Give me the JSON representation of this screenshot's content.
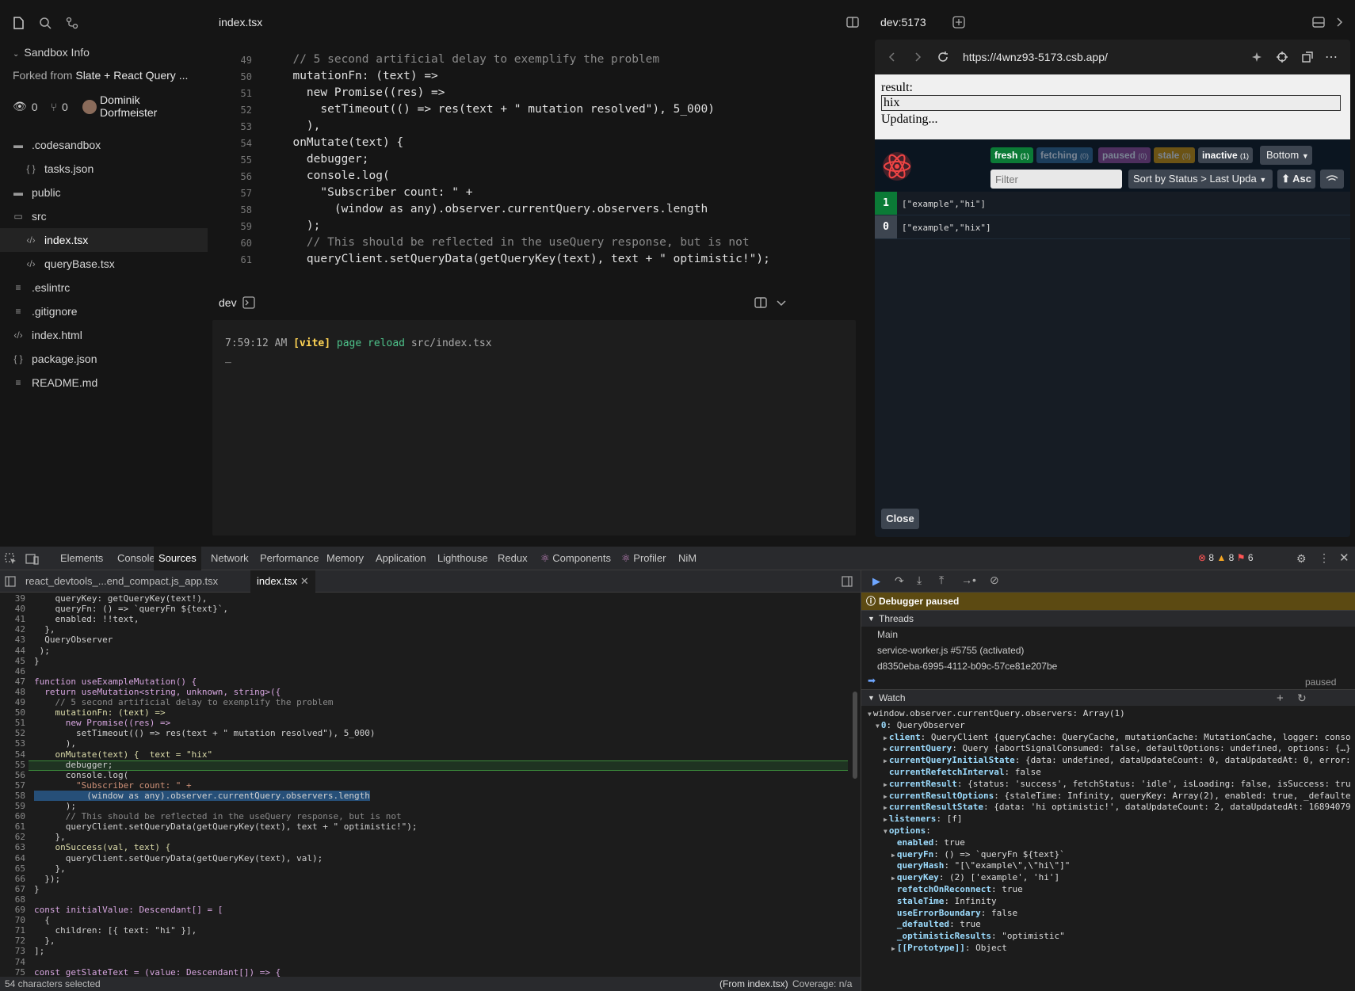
{
  "sidebar": {
    "section_title": "Sandbox Info",
    "forked_label": "Forked from",
    "forked_name": "Slate + React Query ...",
    "views": "0",
    "forks": "0",
    "author": "Dominik Dorfmeister",
    "files": [
      {
        "name": ".codesandbox",
        "icon": "folder-icon"
      },
      {
        "name": "tasks.json",
        "icon": "json-icon"
      },
      {
        "name": "public",
        "icon": "folder-icon"
      },
      {
        "name": "src",
        "icon": "folder-open-icon"
      },
      {
        "name": "index.tsx",
        "icon": "code-icon"
      },
      {
        "name": "queryBase.tsx",
        "icon": "code-icon"
      },
      {
        "name": ".eslintrc",
        "icon": "lines-icon"
      },
      {
        "name": ".gitignore",
        "icon": "lines-icon"
      },
      {
        "name": "index.html",
        "icon": "code-icon"
      },
      {
        "name": "package.json",
        "icon": "json-icon"
      },
      {
        "name": "README.md",
        "icon": "lines-icon"
      }
    ]
  },
  "editor": {
    "tab": "index.tsx",
    "lines": [
      {
        "n": "49",
        "t": "  // 5 second artificial delay to exemplify the problem"
      },
      {
        "n": "50",
        "t": "  mutationFn: (text) =>"
      },
      {
        "n": "51",
        "t": "    new Promise((res) =>"
      },
      {
        "n": "52",
        "t": "      setTimeout(() => res(text + \" mutation resolved\"), 5_000)"
      },
      {
        "n": "53",
        "t": "    ),"
      },
      {
        "n": "54",
        "t": "  onMutate(text) {"
      },
      {
        "n": "55",
        "t": "    debugger;"
      },
      {
        "n": "56",
        "t": "    console.log("
      },
      {
        "n": "57",
        "t": "      \"Subscriber count: \" +"
      },
      {
        "n": "58",
        "t": "        (window as any).observer.currentQuery.observers.length"
      },
      {
        "n": "59",
        "t": "    );"
      },
      {
        "n": "60",
        "t": "    // This should be reflected in the useQuery response, but is not"
      },
      {
        "n": "61",
        "t": "    queryClient.setQueryData(getQueryKey(text), text + \" optimistic!\");"
      }
    ]
  },
  "terminal": {
    "title": "dev",
    "time": "7:59:12 AM",
    "tag": "[vite]",
    "msg": "page reload",
    "path": "src/index.tsx",
    "cursor": "_"
  },
  "preview": {
    "title": "dev:5173",
    "url": "https://4wnz93-5173.csb.app/",
    "result_label": "result:",
    "input_value": "hix",
    "status": "Updating...",
    "close": "Close"
  },
  "rq_devtools": {
    "badges": [
      {
        "label": "fresh",
        "count": "(1)",
        "color": "#0b7a36"
      },
      {
        "label": "fetching",
        "count": "(0)",
        "color": "#1c3e5c"
      },
      {
        "label": "paused",
        "count": "(0)",
        "color": "#4d2f5e"
      },
      {
        "label": "stale",
        "count": "(0)",
        "color": "#6b5315"
      },
      {
        "label": "inactive",
        "count": "(1)",
        "color": "#3d4550"
      }
    ],
    "position_select": "Bottom",
    "filter_placeholder": "Filter",
    "sort_select": "Sort by Status > Last Upda",
    "asc": "⬆ Asc",
    "queries": [
      {
        "count": "1",
        "key": "[\"example\",\"hi\"]",
        "color": "#0b7a36"
      },
      {
        "count": "0",
        "key": "[\"example\",\"hix\"]",
        "color": "#3d4550"
      }
    ]
  },
  "devtools": {
    "tabs": [
      "Elements",
      "Console",
      "Sources",
      "Network",
      "Performance",
      "Memory",
      "Application",
      "Lighthouse",
      "Redux",
      "Components",
      "Profiler",
      "NiM"
    ],
    "active_tab": "Sources",
    "errors": "8",
    "warnings": "8",
    "issues": "6",
    "file_tabs": [
      "react_devtools_...end_compact.js",
      "_app.tsx",
      "index.tsx"
    ],
    "status_left": "54 characters selected",
    "status_mid": "(From index.tsx)",
    "status_right": "Coverage: n/a",
    "src_lines": [
      {
        "n": "39",
        "t": "    queryKey: getQueryKey(text!),"
      },
      {
        "n": "40",
        "t": "    queryFn: () => `queryFn ${text}`,"
      },
      {
        "n": "41",
        "t": "    enabled: !!text,"
      },
      {
        "n": "42",
        "t": "  },"
      },
      {
        "n": "43",
        "t": "  QueryObserver"
      },
      {
        "n": "44",
        "t": " );"
      },
      {
        "n": "45",
        "t": "}"
      },
      {
        "n": "46",
        "t": ""
      },
      {
        "n": "47",
        "t": "function useExampleMutation() {"
      },
      {
        "n": "48",
        "t": "  return useMutation<string, unknown, string>({"
      },
      {
        "n": "49",
        "t": "    // 5 second artificial delay to exemplify the problem"
      },
      {
        "n": "50",
        "t": "    mutationFn: (text) =>"
      },
      {
        "n": "51",
        "t": "      new Promise((res) =>"
      },
      {
        "n": "52",
        "t": "        setTimeout(() => res(text + \" mutation resolved\"), 5_000)"
      },
      {
        "n": "53",
        "t": "      ),"
      },
      {
        "n": "54",
        "t": "    onMutate(text) {  text = \"hix\""
      },
      {
        "n": "55",
        "t": "      debugger;"
      },
      {
        "n": "56",
        "t": "      console.log("
      },
      {
        "n": "57",
        "t": "        \"Subscriber count: \" +"
      },
      {
        "n": "58",
        "t": "          (window as any).observer.currentQuery.observers.length"
      },
      {
        "n": "59",
        "t": "      );"
      },
      {
        "n": "60",
        "t": "      // This should be reflected in the useQuery response, but is not"
      },
      {
        "n": "61",
        "t": "      queryClient.setQueryData(getQueryKey(text), text + \" optimistic!\");"
      },
      {
        "n": "62",
        "t": "    },"
      },
      {
        "n": "63",
        "t": "    onSuccess(val, text) {"
      },
      {
        "n": "64",
        "t": "      queryClient.setQueryData(getQueryKey(text), val);"
      },
      {
        "n": "65",
        "t": "    },"
      },
      {
        "n": "66",
        "t": "  });"
      },
      {
        "n": "67",
        "t": "}"
      },
      {
        "n": "68",
        "t": ""
      },
      {
        "n": "69",
        "t": "const initialValue: Descendant[] = ["
      },
      {
        "n": "70",
        "t": "  {"
      },
      {
        "n": "71",
        "t": "    children: [{ text: \"hi\" }],"
      },
      {
        "n": "72",
        "t": "  },"
      },
      {
        "n": "73",
        "t": "];"
      },
      {
        "n": "74",
        "t": ""
      },
      {
        "n": "75",
        "t": "const getSlateText = (value: Descendant[]) => {"
      }
    ],
    "debugger_paused": "Debugger paused",
    "threads_title": "Threads",
    "threads": [
      "Main",
      "service-worker.js #5755 (activated)",
      "d8350eba-6995-4112-b09c-57ce81e207be"
    ],
    "paused_label": "paused",
    "watch_title": "Watch",
    "watch_lines": [
      {
        "k": "window.observer.currentQuery.observers",
        "v": ": Array(1)"
      },
      {
        "k": "0",
        "v": ": QueryObserver"
      },
      {
        "k": "client",
        "v": ": QueryClient {queryCache: QueryCache, mutationCache: MutationCache, logger: conso"
      },
      {
        "k": "currentQuery",
        "v": ": Query {abortSignalConsumed: false, defaultOptions: undefined, options: {…}"
      },
      {
        "k": "currentQueryInitialState",
        "v": ": {data: undefined, dataUpdateCount: 0, dataUpdatedAt: 0, error:"
      },
      {
        "k": "currentRefetchInterval",
        "v": ": false"
      },
      {
        "k": "currentResult",
        "v": ": {status: 'success', fetchStatus: 'idle', isLoading: false, isSuccess: tru"
      },
      {
        "k": "currentResultOptions",
        "v": ": {staleTime: Infinity, queryKey: Array(2), enabled: true, _defaulte"
      },
      {
        "k": "currentResultState",
        "v": ": {data: 'hi optimistic!', dataUpdateCount: 2, dataUpdatedAt: 16894079"
      },
      {
        "k": "listeners",
        "v": ": [f]"
      },
      {
        "k": "options",
        "v": ":"
      },
      {
        "k": "enabled",
        "v": ": true"
      },
      {
        "k": "queryFn",
        "v": ": () => `queryFn ${text}`"
      },
      {
        "k": "queryHash",
        "v": ": \"[\\\"example\\\",\\\"hi\\\"]\""
      },
      {
        "k": "queryKey",
        "v": ": (2) ['example', 'hi']"
      },
      {
        "k": "refetchOnReconnect",
        "v": ": true"
      },
      {
        "k": "staleTime",
        "v": ": Infinity"
      },
      {
        "k": "useErrorBoundary",
        "v": ": false"
      },
      {
        "k": "_defaulted",
        "v": ": true"
      },
      {
        "k": "_optimisticResults",
        "v": ": \"optimistic\""
      },
      {
        "k": "[[Prototype]]",
        "v": ": Object"
      }
    ]
  }
}
